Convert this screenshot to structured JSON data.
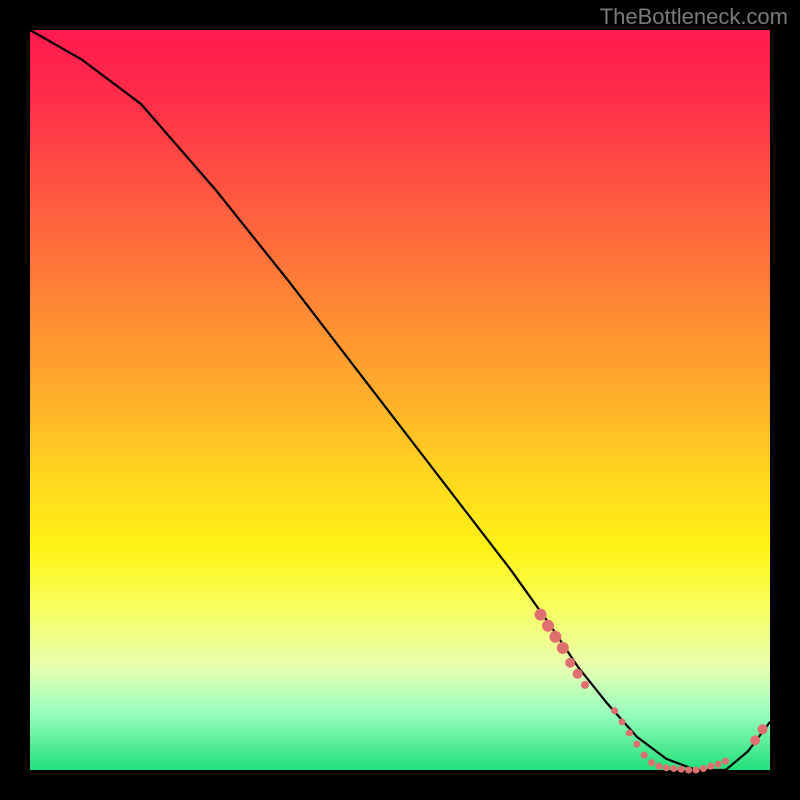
{
  "attribution": "TheBottleneck.com",
  "chart_data": {
    "type": "line",
    "title": "",
    "xlabel": "",
    "ylabel": "",
    "xlim": [
      0,
      100
    ],
    "ylim": [
      0,
      100
    ],
    "grid": false,
    "legend": false,
    "series": [
      {
        "name": "curve",
        "x": [
          0,
          7,
          15,
          25,
          35,
          45,
          55,
          65,
          70,
          74,
          78,
          82,
          86,
          90,
          94,
          97,
          100
        ],
        "y": [
          100,
          96,
          90,
          78.5,
          66,
          53,
          40,
          27,
          20,
          14,
          9,
          4.5,
          1.5,
          0,
          0,
          2.5,
          6.5
        ]
      }
    ],
    "markers": [
      {
        "name": "cluster-left",
        "x": 69,
        "y": 21,
        "r": 6,
        "color": "#e07070"
      },
      {
        "name": "cluster-left",
        "x": 70,
        "y": 19.5,
        "r": 6,
        "color": "#e07070"
      },
      {
        "name": "cluster-left",
        "x": 71,
        "y": 18,
        "r": 6,
        "color": "#e07070"
      },
      {
        "name": "cluster-left",
        "x": 72,
        "y": 16.5,
        "r": 6,
        "color": "#e07070"
      },
      {
        "name": "cluster-left",
        "x": 73,
        "y": 14.5,
        "r": 5,
        "color": "#e07070"
      },
      {
        "name": "cluster-left",
        "x": 74,
        "y": 13,
        "r": 5,
        "color": "#e07070"
      },
      {
        "name": "cluster-left",
        "x": 75,
        "y": 11.5,
        "r": 4,
        "color": "#e07070"
      },
      {
        "name": "trough",
        "x": 79,
        "y": 8,
        "r": 3.5,
        "color": "#e07070"
      },
      {
        "name": "trough",
        "x": 80,
        "y": 6.5,
        "r": 3.5,
        "color": "#e07070"
      },
      {
        "name": "trough",
        "x": 81,
        "y": 5,
        "r": 3.5,
        "color": "#e07070"
      },
      {
        "name": "trough",
        "x": 82,
        "y": 3.5,
        "r": 3.5,
        "color": "#e07070"
      },
      {
        "name": "trough",
        "x": 83,
        "y": 2,
        "r": 3.5,
        "color": "#e07070"
      },
      {
        "name": "trough",
        "x": 84,
        "y": 1,
        "r": 3.5,
        "color": "#e07070"
      },
      {
        "name": "trough",
        "x": 85,
        "y": 0.5,
        "r": 3.5,
        "color": "#e07070"
      },
      {
        "name": "trough",
        "x": 86,
        "y": 0.3,
        "r": 3.5,
        "color": "#e07070"
      },
      {
        "name": "trough",
        "x": 87,
        "y": 0.2,
        "r": 3.5,
        "color": "#e07070"
      },
      {
        "name": "trough",
        "x": 88,
        "y": 0.1,
        "r": 3.5,
        "color": "#e07070"
      },
      {
        "name": "trough",
        "x": 89,
        "y": 0,
        "r": 3.5,
        "color": "#e07070"
      },
      {
        "name": "trough",
        "x": 90,
        "y": 0,
        "r": 3.5,
        "color": "#e07070"
      },
      {
        "name": "trough",
        "x": 91,
        "y": 0.2,
        "r": 3.5,
        "color": "#e07070"
      },
      {
        "name": "trough",
        "x": 92,
        "y": 0.5,
        "r": 3.5,
        "color": "#e07070"
      },
      {
        "name": "trough",
        "x": 93,
        "y": 0.8,
        "r": 3.5,
        "color": "#e07070"
      },
      {
        "name": "trough",
        "x": 94,
        "y": 1.2,
        "r": 3.5,
        "color": "#e07070"
      },
      {
        "name": "right-pair",
        "x": 98,
        "y": 4,
        "r": 5,
        "color": "#e07070"
      },
      {
        "name": "right-pair",
        "x": 99,
        "y": 5.5,
        "r": 5,
        "color": "#e07070"
      }
    ],
    "colors": {
      "line": "#000000",
      "marker": "#e07070",
      "gradient_top": "#ff1a4d",
      "gradient_bottom": "#22e07a"
    }
  }
}
